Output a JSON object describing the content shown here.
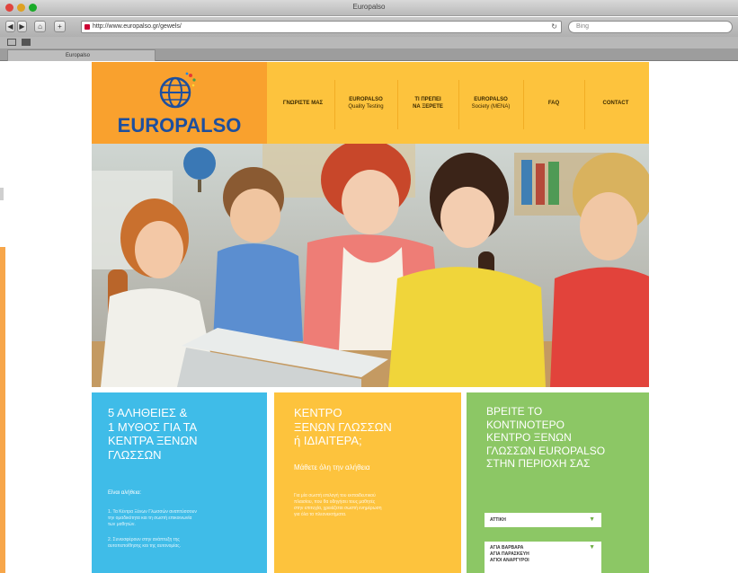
{
  "browser": {
    "window_title": "Europalso",
    "url": "http://www.europalso.gr/gewels/",
    "search_placeholder": "Bing",
    "tab_label": "Europalso",
    "buttons": {
      "back": "◀",
      "forward": "▶",
      "home": "⌂",
      "add": "+"
    }
  },
  "site": {
    "logo_text": "EUROPALSO",
    "nav": [
      {
        "line1": "ΓΝΩΡΙΣΤΕ ΜΑΣ",
        "line2": ""
      },
      {
        "line1": "EUROPALSO",
        "line2": "Quality Testing"
      },
      {
        "line1": "ΤΙ ΠΡΕΠΕΙ",
        "line2": "ΝΑ ΞΕΡΕΤΕ"
      },
      {
        "line1": "EUROPALSO",
        "line2": "Society (MENA)"
      },
      {
        "line1": "FAQ",
        "line2": ""
      },
      {
        "line1": "CONTACT",
        "line2": ""
      }
    ],
    "panels": {
      "blue": {
        "title": [
          "5 ΑΛΗΘΕΙΕΣ &",
          "1 ΜΥΘΟΣ ΓΙΑ ΤΑ",
          "ΚΕΝΤΡΑ ΞΕΝΩΝ",
          "ΓΛΩΣΣΩΝ"
        ],
        "sub": "Είναι αλήθεια:",
        "body": [
          "1. Τα Κέντρα Ξένων Γλωσσών αναπτύσσουν",
          "    την ομαδικότητα και τη σωστή επικοινωνία",
          "    των μαθητών.",
          "2. Συνεισφέρουν στην ανάπτυξη της",
          "    αυτοπεποίθησης και της αυτονομίας."
        ]
      },
      "yellow": {
        "title": [
          "ΚΕΝΤΡΟ",
          "ΞΕΝΩΝ ΓΛΩΣΣΩΝ",
          "ή ΙΔΙΑΙΤΕΡΑ;"
        ],
        "sub": "Μάθετε όλη την αλήθεια",
        "body": [
          "Για μία σωστή επιλογή του εκπαιδευτικού",
          "πλαισίου, που θα οδηγήσει τους μαθητές",
          "στην επιτυχία, χρειάζεται σωστή ενημέρωση",
          "για όλα τα πλεονεκτήματα."
        ]
      },
      "green": {
        "title": [
          "ΒΡΕΙΤΕ ΤΟ",
          "ΚΟΝΤΙΝΟΤΕΡΟ",
          "ΚΕΝΤΡΟ ΞΕΝΩΝ",
          "ΓΛΩΣΣΩΝ EUROPALSO",
          "ΣΤΗΝ ΠΕΡΙΟΧΗ ΣΑΣ"
        ],
        "select1": "ΑΤΤΙΚΗ",
        "select2": [
          "ΑΓΙΑ ΒΑΡΒΑΡΑ",
          "ΑΓΙΑ ΠΑΡΑΣΚΕΥΗ",
          "ΑΓΙΟΙ ΑΝΑΡΓΥΡΟΙ"
        ]
      }
    }
  },
  "colors": {
    "orange": "#f9a12e",
    "yellow": "#fdc33d",
    "blue": "#3fbce8",
    "green": "#8cc765",
    "logo_blue": "#1d4f9e"
  }
}
